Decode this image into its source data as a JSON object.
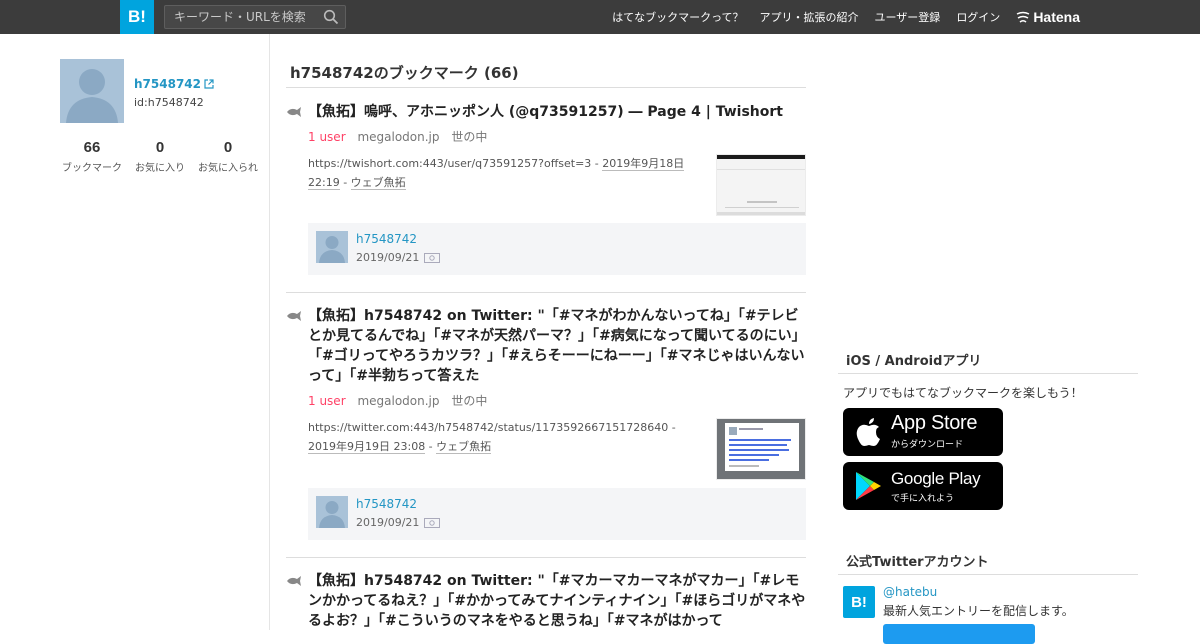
{
  "header": {
    "logo": "B!",
    "search_placeholder": "キーワード・URLを検索",
    "nav": [
      "はてなブックマークって？",
      "アプリ・拡張の紹介",
      "ユーザー登録",
      "ログイン"
    ],
    "brand": "Hatena"
  },
  "profile": {
    "name": "h7548742",
    "id_text": "id:h7548742",
    "stats": [
      {
        "num": "66",
        "label": "ブックマーク"
      },
      {
        "num": "0",
        "label": "お気に入り"
      },
      {
        "num": "0",
        "label": "お気に入られ"
      }
    ]
  },
  "main": {
    "title": "h7548742のブックマーク (66)",
    "entries": [
      {
        "title": "【魚拓】嗚呼、アホニッポン人 (@q73591257) ― Page 4 | Twishort",
        "users": "1 user",
        "domain": "megalodon.jp",
        "category": "世の中",
        "url_prefix": "https://twishort.com:443/user/q73591257?offset=3 - ",
        "date": "2019年9月18日 22:19",
        "sep": " - ",
        "source": "ウェブ魚拓",
        "bm_user": "h7548742",
        "bm_date": "2019/09/21"
      },
      {
        "title": "【魚拓】h7548742 on Twitter: \"「#マネがわかんないってね」「#テレビとか見てるんでね」「#マネが天然パーマ？」「#病気になって聞いてるのにい」「#ゴリってやろうカツラ？」「#えらそーーにねーー」「#マネじゃはいんないって」「#半勃ちって答えた",
        "users": "1 user",
        "domain": "megalodon.jp",
        "category": "世の中",
        "url_prefix": "https://twitter.com:443/h7548742/status/1173592667151728640 - ",
        "date": "2019年9月19日 23:08",
        "sep": " - ",
        "source": "ウェブ魚拓",
        "bm_user": "h7548742",
        "bm_date": "2019/09/21"
      },
      {
        "title": "【魚拓】h7548742 on Twitter: \"「#マカーマカーマネがマカー」「#レモンかかってるねえ？」「#かかってみてナインティナイン」「#ほらゴリがマネやるよお？」「#こういうのマネをやると思うね」「#マネがはかって"
      }
    ]
  },
  "sidebar": {
    "apps_heading": "iOS / Androidアプリ",
    "apps_text": "アプリでもはてなブックマークを楽しもう！",
    "appstore_big": "App Store",
    "appstore_small": "からダウンロード",
    "googleplay_big": "Google Play",
    "googleplay_small": "で手に入れよう",
    "twitter_heading": "公式Twitterアカウント",
    "twitter_logo": "B!",
    "twitter_handle": "@hatebu",
    "twitter_desc": "最新人気エントリーを配信します。"
  }
}
